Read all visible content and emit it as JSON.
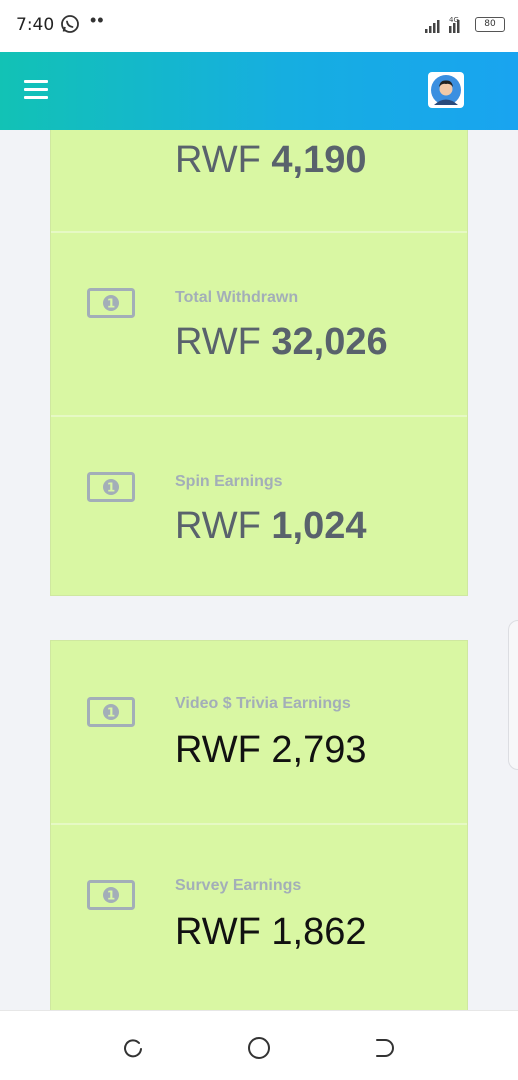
{
  "status_bar": {
    "time": "7:40",
    "network": "4G",
    "battery": "80",
    "icons": [
      "whatsapp-icon",
      "signal-icon",
      "battery-icon"
    ]
  },
  "app_bar": {
    "icons": [
      "hamburger-menu-icon",
      "user-avatar"
    ],
    "gradient_start": "#12c2b5",
    "gradient_end": "#19a4f0"
  },
  "cards": [
    {
      "stats": [
        {
          "label": "",
          "currency": "RWF",
          "amount": "4,190"
        },
        {
          "label": "Total Withdrawn",
          "currency": "RWF",
          "amount": "32,026"
        },
        {
          "label": "Spin Earnings",
          "currency": "RWF",
          "amount": "1,024"
        }
      ]
    },
    {
      "stats": [
        {
          "label": "Video $ Trivia Earnings",
          "currency": "RWF",
          "amount": "2,793"
        },
        {
          "label": "Survey Earnings",
          "currency": "RWF",
          "amount": "1,862"
        }
      ]
    }
  ],
  "colors": {
    "card_background": "#d9f7a3",
    "page_background": "#f2f3f7",
    "label": "#a3aeb8"
  },
  "nav_bar": {
    "icons": [
      "recent-apps-icon",
      "home-icon",
      "back-icon"
    ]
  }
}
